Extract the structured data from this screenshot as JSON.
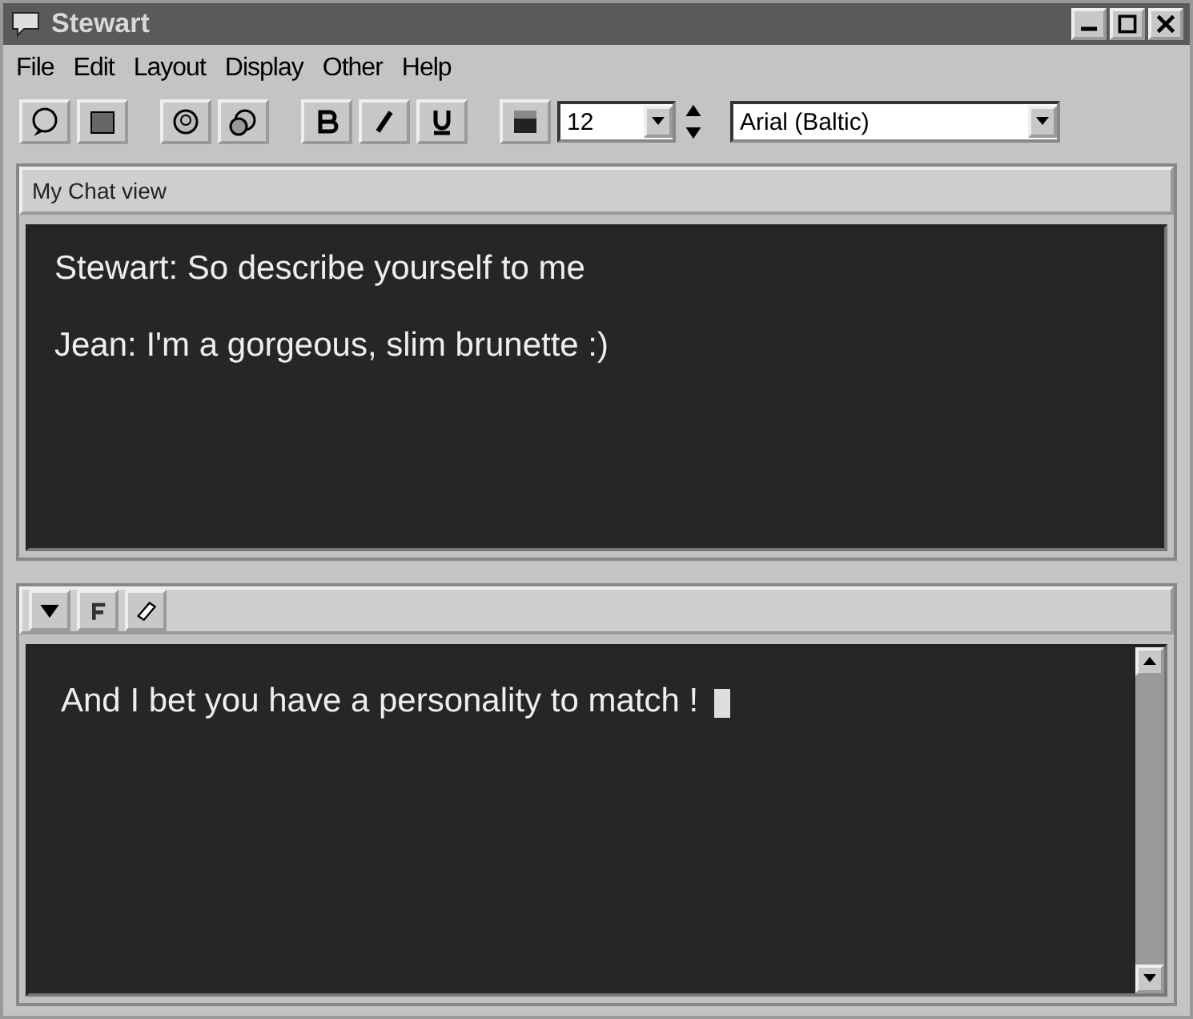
{
  "window": {
    "title": "Stewart"
  },
  "menu": [
    "File",
    "Edit",
    "Layout",
    "Display",
    "Other",
    "Help"
  ],
  "toolbar": {
    "font_size": "12",
    "font_name": "Arial (Baltic)"
  },
  "chat_view": {
    "title": "My Chat view",
    "messages": [
      "Stewart: So describe yourself to me",
      "Jean: I'm a gorgeous, slim brunette :)"
    ]
  },
  "compose": {
    "value": "And I bet you have a personality to match !"
  }
}
